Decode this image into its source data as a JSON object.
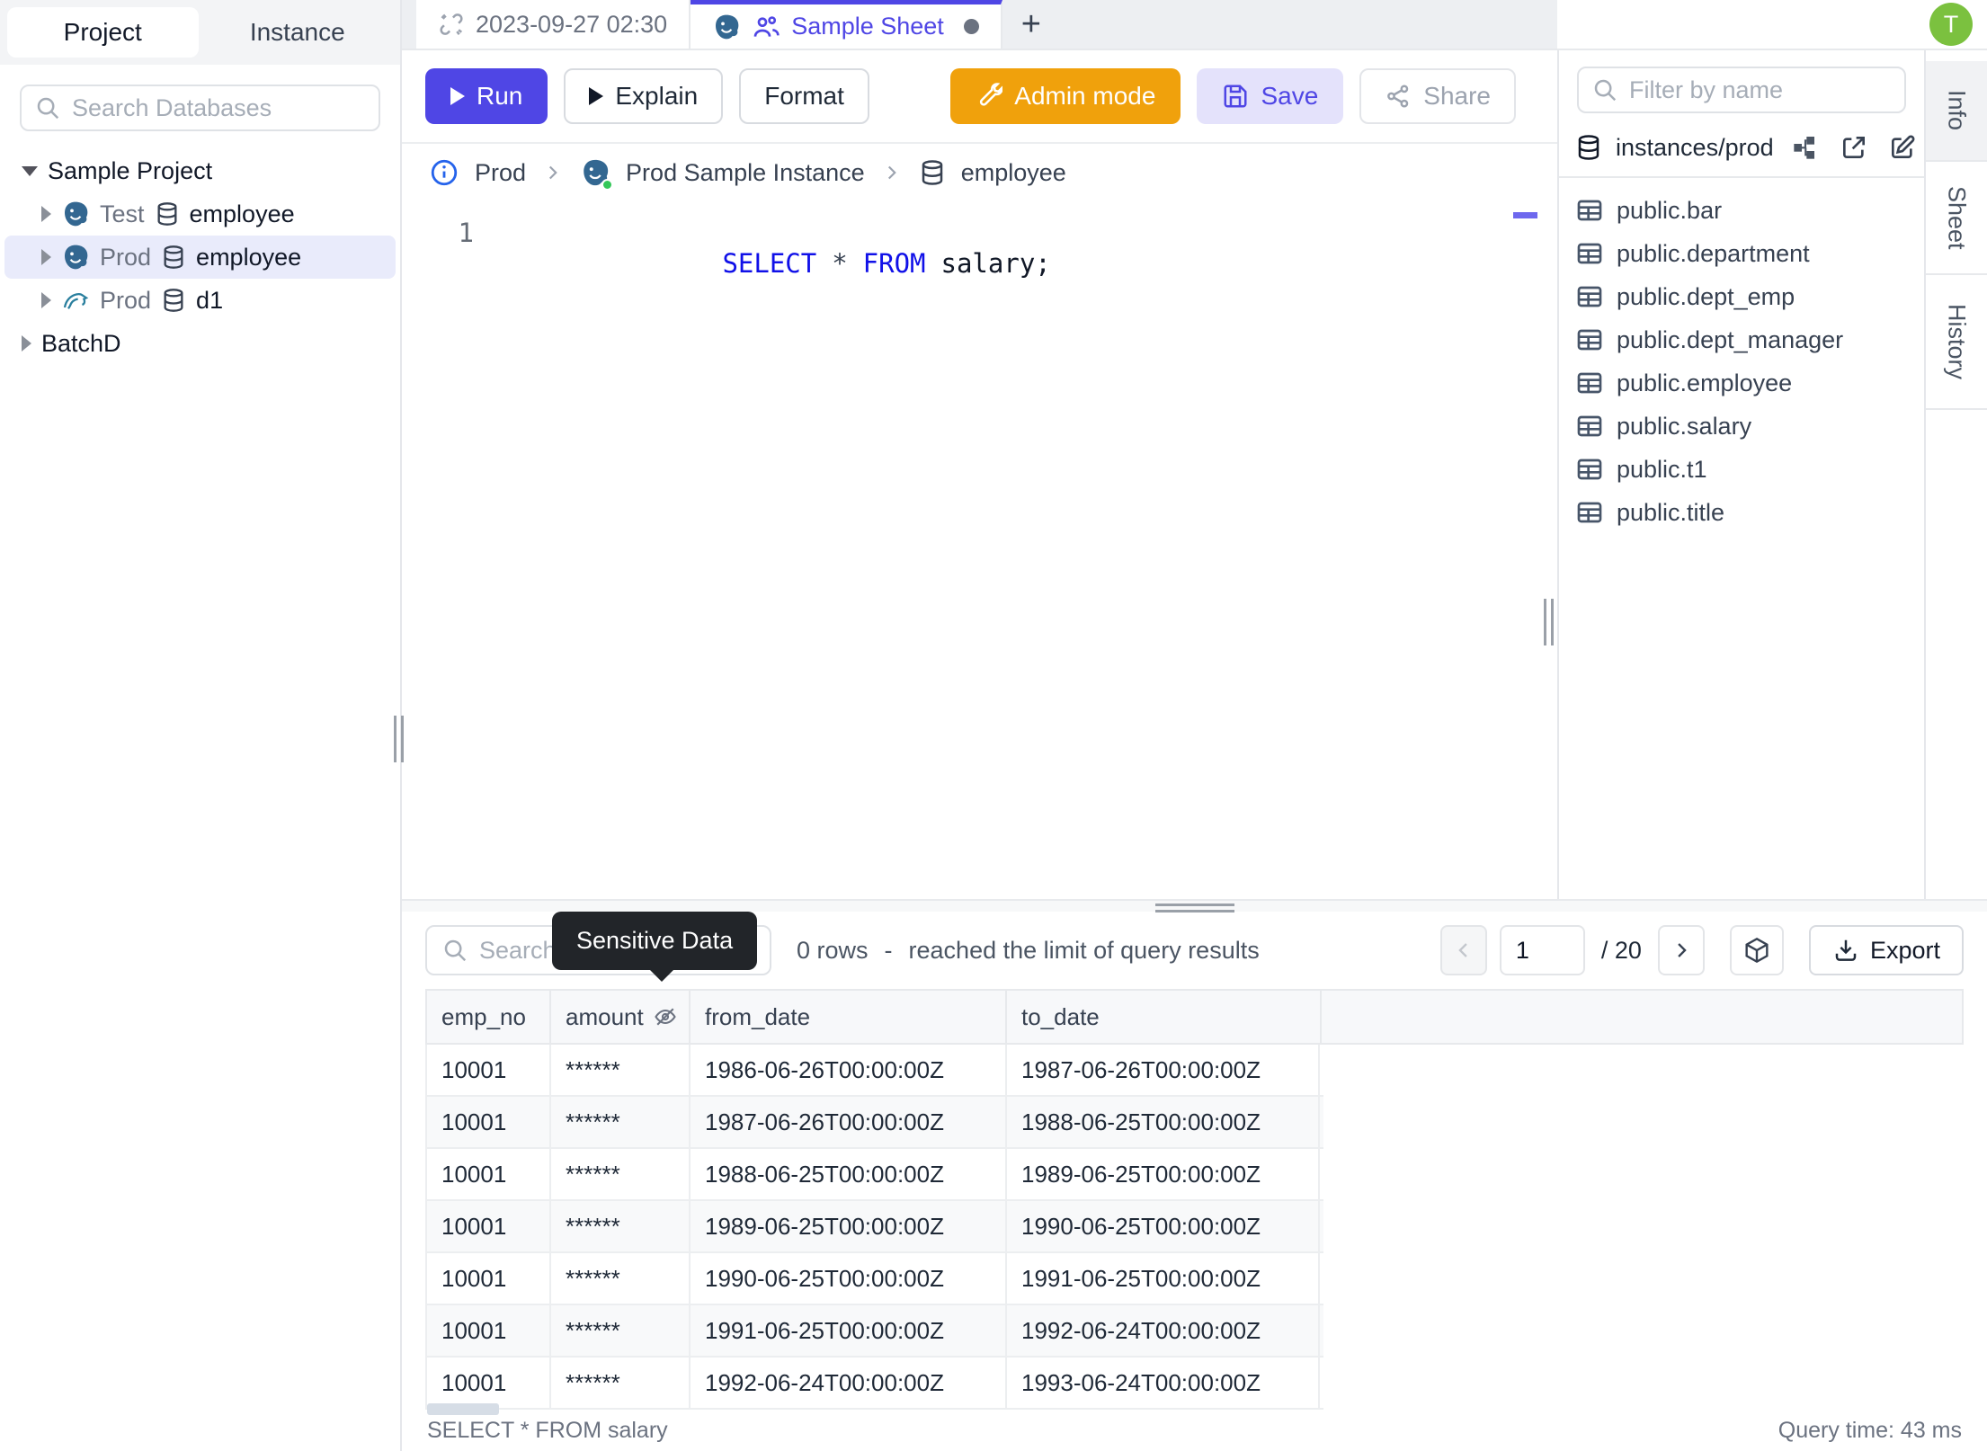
{
  "sidebar": {
    "tabs": {
      "project": "Project",
      "instance": "Instance"
    },
    "search_placeholder": "Search Databases",
    "tree": {
      "project_label": "Sample Project",
      "items": [
        {
          "env": "Test",
          "db": "employee",
          "engine": "postgres"
        },
        {
          "env": "Prod",
          "db": "employee",
          "engine": "postgres"
        },
        {
          "env": "Prod",
          "db": "d1",
          "engine": "mysql"
        }
      ],
      "batch_label": "BatchD"
    }
  },
  "topbar": {
    "tab1": "2023-09-27 02:30",
    "tab2": "Sample Sheet",
    "plus": "+",
    "avatar": "T"
  },
  "toolbar": {
    "run": "Run",
    "explain": "Explain",
    "format": "Format",
    "admin_mode": "Admin mode",
    "save": "Save",
    "share": "Share"
  },
  "breadcrumb": {
    "env": "Prod",
    "instance": "Prod Sample Instance",
    "database": "employee"
  },
  "editor": {
    "line_number": "1",
    "kw_select": "SELECT",
    "star": "*",
    "kw_from": "FROM",
    "tail": "salary;"
  },
  "right_panel": {
    "filter_placeholder": "Filter by name",
    "source_label": "instances/prod",
    "tables": [
      "public.bar",
      "public.department",
      "public.dept_emp",
      "public.dept_manager",
      "public.employee",
      "public.salary",
      "public.t1",
      "public.title"
    ]
  },
  "side_tabs": {
    "info": "Info",
    "sheet": "Sheet",
    "history": "History"
  },
  "results": {
    "search_placeholder": "Search",
    "tooltip": "Sensitive Data",
    "rows_count": "0 rows",
    "separator": "-",
    "limit_note": "reached the limit of query results",
    "page_value": "1",
    "page_total": "/ 20",
    "export_label": "Export",
    "table": {
      "columns": [
        "emp_no",
        "amount",
        "from_date",
        "to_date"
      ],
      "rows": [
        [
          "10001",
          "******",
          "1986-06-26T00:00:00Z",
          "1987-06-26T00:00:00Z"
        ],
        [
          "10001",
          "******",
          "1987-06-26T00:00:00Z",
          "1988-06-25T00:00:00Z"
        ],
        [
          "10001",
          "******",
          "1988-06-25T00:00:00Z",
          "1989-06-25T00:00:00Z"
        ],
        [
          "10001",
          "******",
          "1989-06-25T00:00:00Z",
          "1990-06-25T00:00:00Z"
        ],
        [
          "10001",
          "******",
          "1990-06-25T00:00:00Z",
          "1991-06-25T00:00:00Z"
        ],
        [
          "10001",
          "******",
          "1991-06-25T00:00:00Z",
          "1992-06-24T00:00:00Z"
        ],
        [
          "10001",
          "******",
          "1992-06-24T00:00:00Z",
          "1993-06-24T00:00:00Z"
        ]
      ]
    },
    "status_query": "SELECT * FROM salary",
    "status_time": "Query time: 43 ms"
  },
  "colors": {
    "accent": "#4f46e5",
    "admin_orange": "#f0a10c",
    "avatar_green": "#7bc13f",
    "keyword_blue": "#1010e8",
    "tooltip_bg": "#222529",
    "selected_row_bg": "#e9ebfb"
  }
}
